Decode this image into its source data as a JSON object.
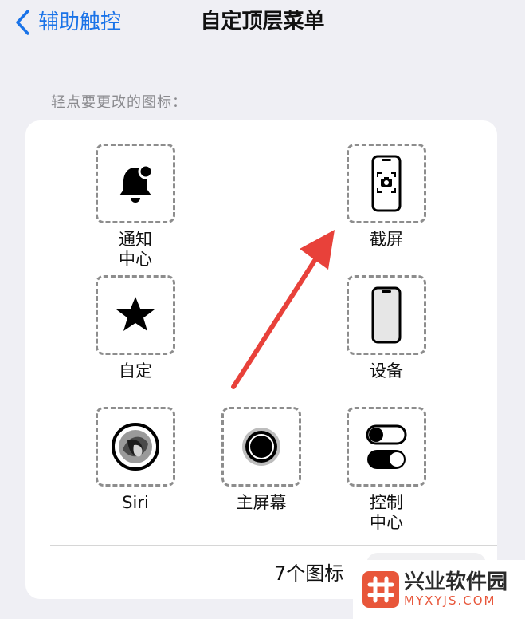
{
  "nav": {
    "back_label": "辅助触控",
    "title": "自定顶层菜单"
  },
  "hint": "轻点要更改的图标：",
  "slots": [
    {
      "label": "通知\n中心",
      "icon": "bell-icon"
    },
    {
      "label": "截屏",
      "icon": "screenshot-icon"
    },
    {
      "label": "自定",
      "icon": "star-icon"
    },
    {
      "label": "设备",
      "icon": "iphone-icon"
    },
    {
      "label": "Siri",
      "icon": "siri-icon"
    },
    {
      "label": "主屏幕",
      "icon": "home-button-icon"
    },
    {
      "label": "控制\n中心",
      "icon": "toggle-switches-icon"
    }
  ],
  "footer": {
    "count_label": "7个图标"
  },
  "colors": {
    "accent": "#1a73e8",
    "arrow": "#e8413a",
    "watermark": "#e8563a"
  },
  "watermark": {
    "name": "兴业软件园",
    "url": "MYXYJS.COM"
  }
}
